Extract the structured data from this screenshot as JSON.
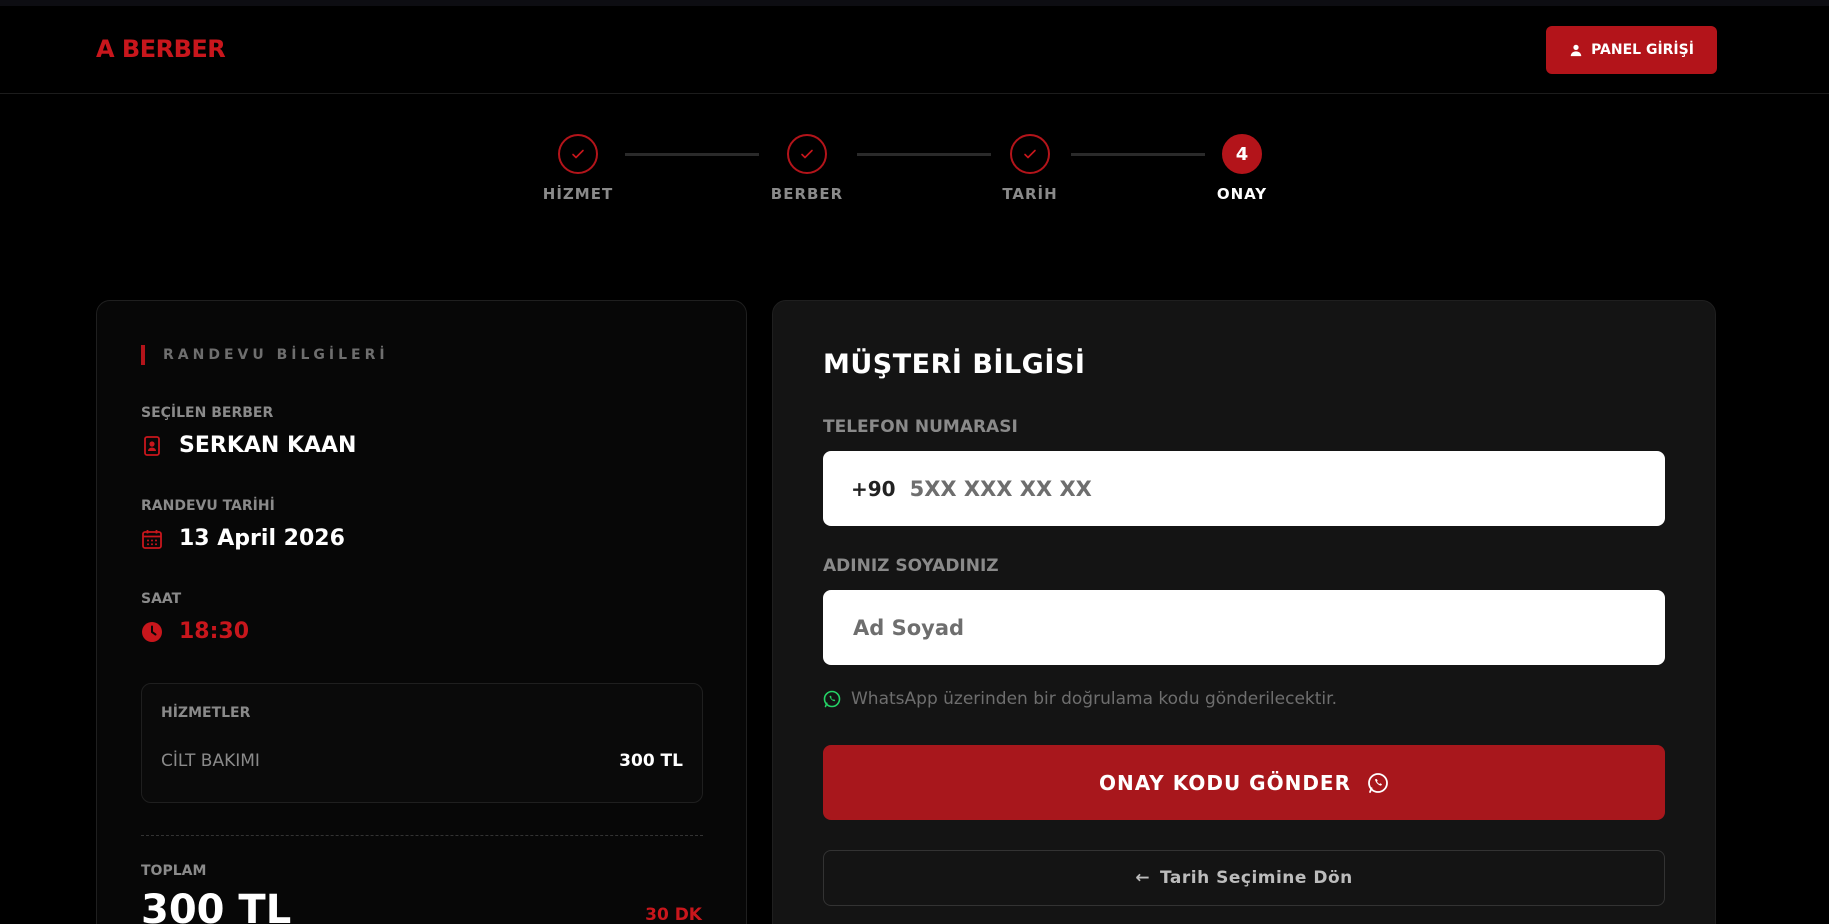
{
  "header": {
    "logo": "A BERBER",
    "panel_button": "PANEL GİRİŞİ"
  },
  "stepper": {
    "steps": [
      {
        "label": "HİZMET",
        "state": "done"
      },
      {
        "label": "BERBER",
        "state": "done"
      },
      {
        "label": "TARİH",
        "state": "done"
      },
      {
        "label": "ONAY",
        "state": "active",
        "number": "4"
      }
    ]
  },
  "summary": {
    "heading": "RANDEVU BİLGİLERİ",
    "barber_label": "SEÇİLEN BERBER",
    "barber_value": "SERKAN KAAN",
    "date_label": "RANDEVU TARİHİ",
    "date_value": "13 April 2026",
    "time_label": "SAAT",
    "time_value": "18:30",
    "services_label": "HİZMETLER",
    "services": [
      {
        "name": "CİLT BAKIMI",
        "price": "300 TL"
      }
    ],
    "total_label": "TOPLAM",
    "total_value": "300 TL",
    "duration": "30 DK"
  },
  "form": {
    "title": "MÜŞTERİ BİLGİSİ",
    "phone_label": "TELEFON NUMARASI",
    "phone_prefix": "+90",
    "phone_placeholder": "5XX XXX XX XX",
    "name_label": "ADINIZ SOYADINIZ",
    "name_placeholder": "Ad Soyad",
    "whatsapp_note": "WhatsApp üzerinden bir doğrulama kodu gönderilecektir.",
    "send_button": "ONAY KODU GÖNDER",
    "back_button": "Tarih Seçimine Dön"
  },
  "colors": {
    "accent": "#b3141a",
    "whatsapp": "#25d366",
    "card": "#141414"
  },
  "icons": [
    "user-icon",
    "check-icon",
    "barber-badge-icon",
    "calendar-icon",
    "clock-icon",
    "whatsapp-icon",
    "arrow-left-icon"
  ]
}
